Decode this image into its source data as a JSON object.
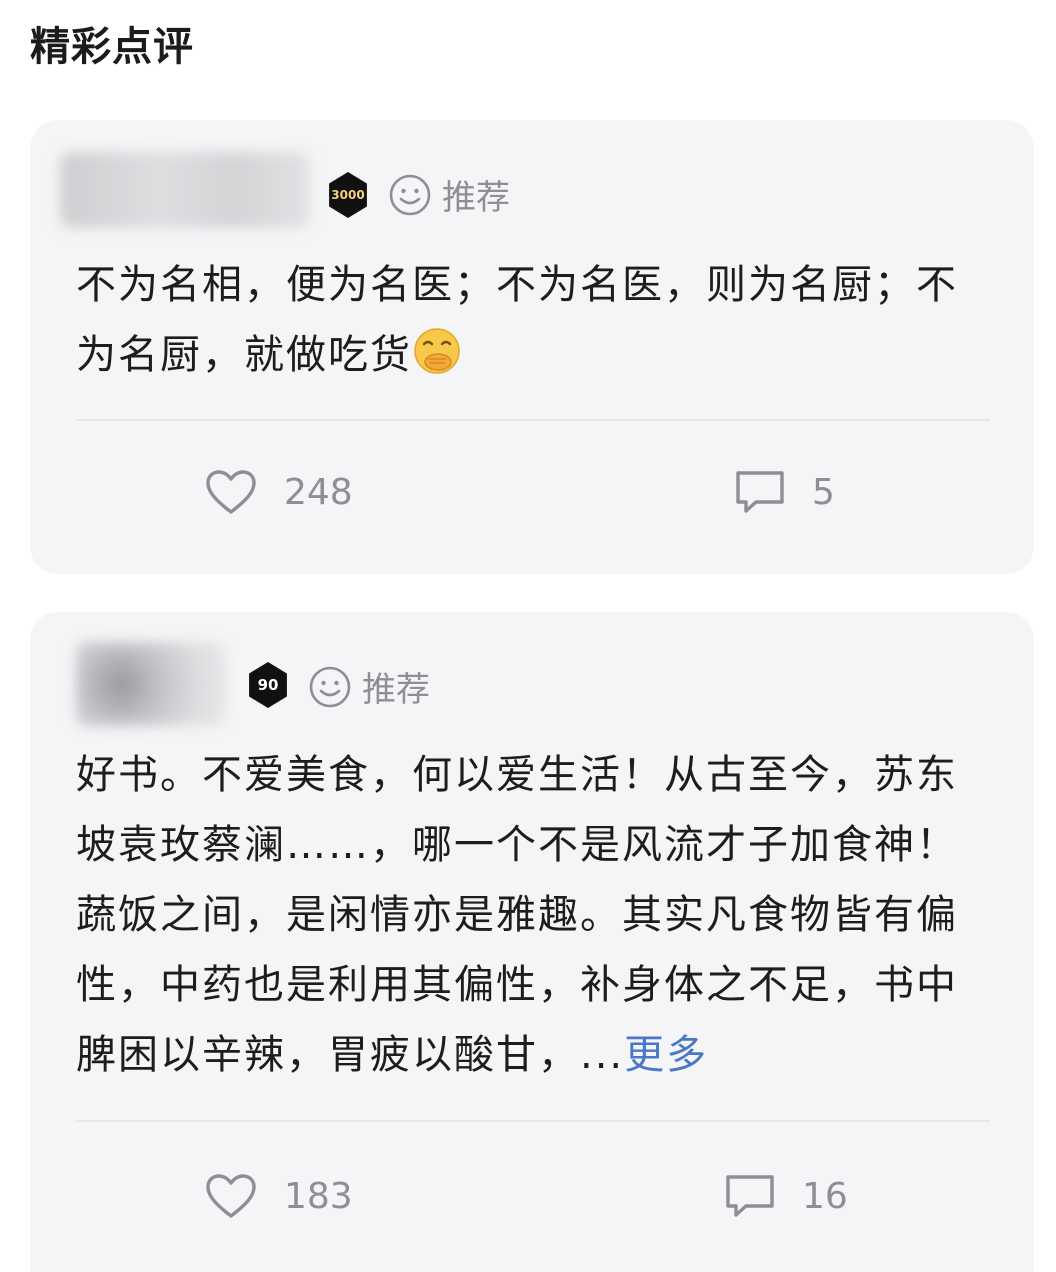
{
  "section": {
    "title": "精彩点评"
  },
  "reviews": [
    {
      "badge": "3000",
      "recommend_label": "推荐",
      "text": "不为名相，便为名医；不为名医，则为名厨；不为名厨，就做吃货",
      "emoji": "hand-over-mouth-face",
      "likes": "248",
      "comments": "5"
    },
    {
      "badge": "90",
      "recommend_label": "推荐",
      "text": "好书。不爱美食，何以爱生活！从古至今，苏东坡袁玫蔡澜……，哪一个不是风流才子加食神！蔬饭之间，是闲情亦是雅趣。其实凡食物皆有偏性，中药也是利用其偏性，补身体之不足，书中脾困以辛辣，胃疲以酸甘，",
      "ellipsis": "...",
      "more_label": "更多",
      "likes": "183",
      "comments": "16"
    }
  ],
  "colors": {
    "card_bg": "#f5f5f7",
    "muted": "#8e8e93",
    "link": "#4a78c7"
  }
}
